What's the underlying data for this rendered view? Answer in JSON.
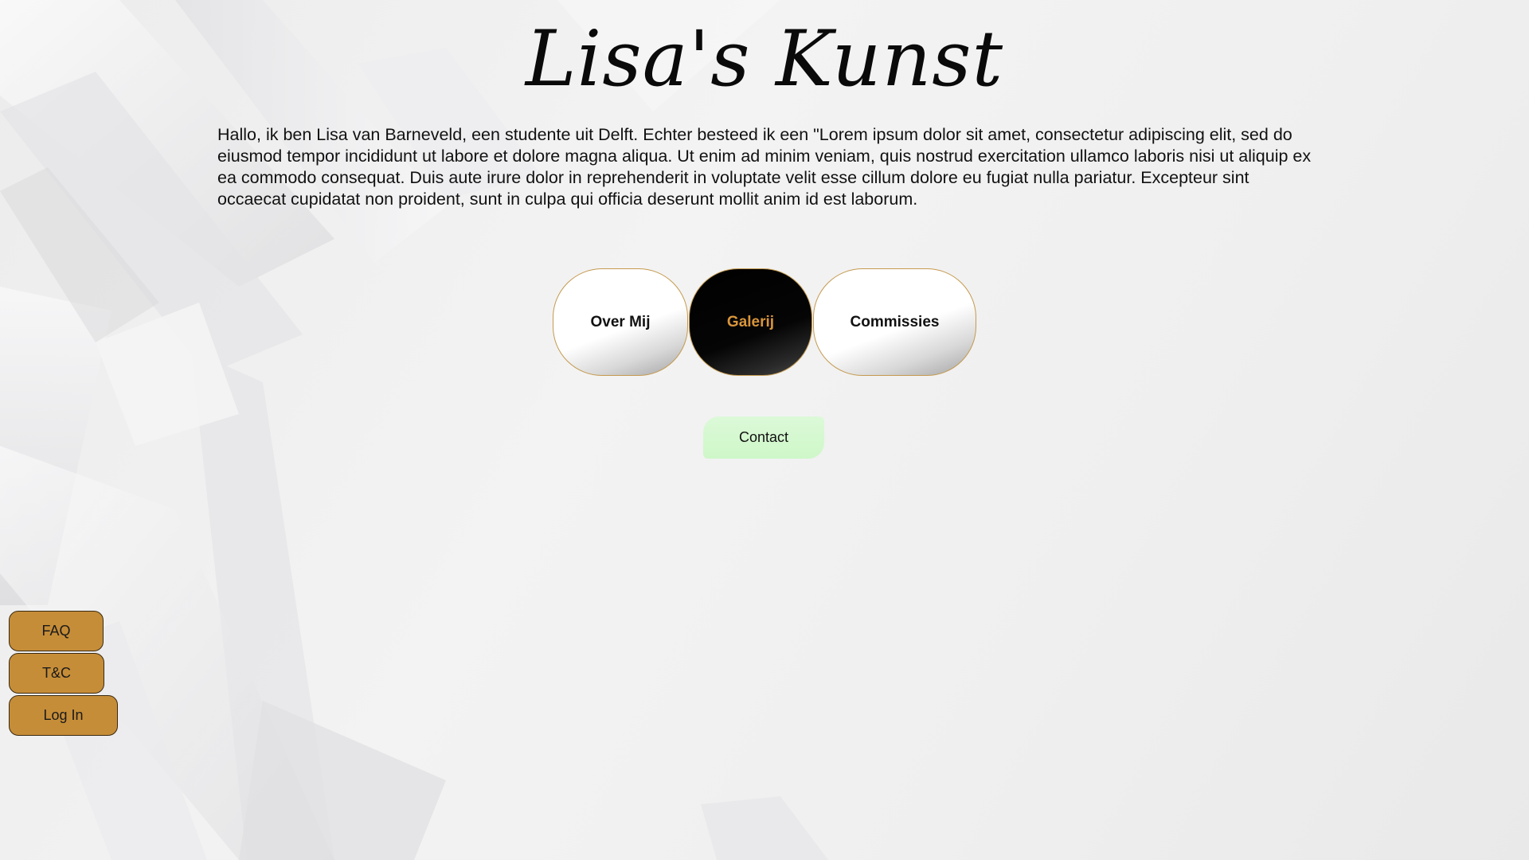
{
  "header": {
    "title": "Lisa's Kunst"
  },
  "intro": {
    "text": "Hallo, ik ben Lisa van Barneveld, een studente uit Delft. Echter besteed ik een \"Lorem ipsum dolor sit amet, consectetur adipiscing elit, sed do eiusmod tempor incididunt ut labore et dolore magna aliqua. Ut enim ad minim veniam, quis nostrud exercitation ullamco laboris nisi ut aliquip ex ea commodo consequat. Duis aute irure dolor in reprehenderit in voluptate velit esse cillum dolore eu fugiat nulla pariatur. Excepteur sint occaecat cupidatat non proident, sunt in culpa qui officia deserunt mollit anim id est laborum."
  },
  "nav": {
    "items": [
      {
        "label": "Over Mij",
        "active": false
      },
      {
        "label": "Galerij",
        "active": true
      },
      {
        "label": "Commissies",
        "active": false
      }
    ]
  },
  "contact": {
    "label": "Contact"
  },
  "side_menu": {
    "items": [
      {
        "label": "FAQ"
      },
      {
        "label": "T&C"
      },
      {
        "label": "Log In"
      }
    ]
  },
  "colors": {
    "accent_gold": "#c68d38",
    "active_text": "#d8953a",
    "contact_green": "#d4f8cf",
    "nav_border": "#c59a4f"
  }
}
